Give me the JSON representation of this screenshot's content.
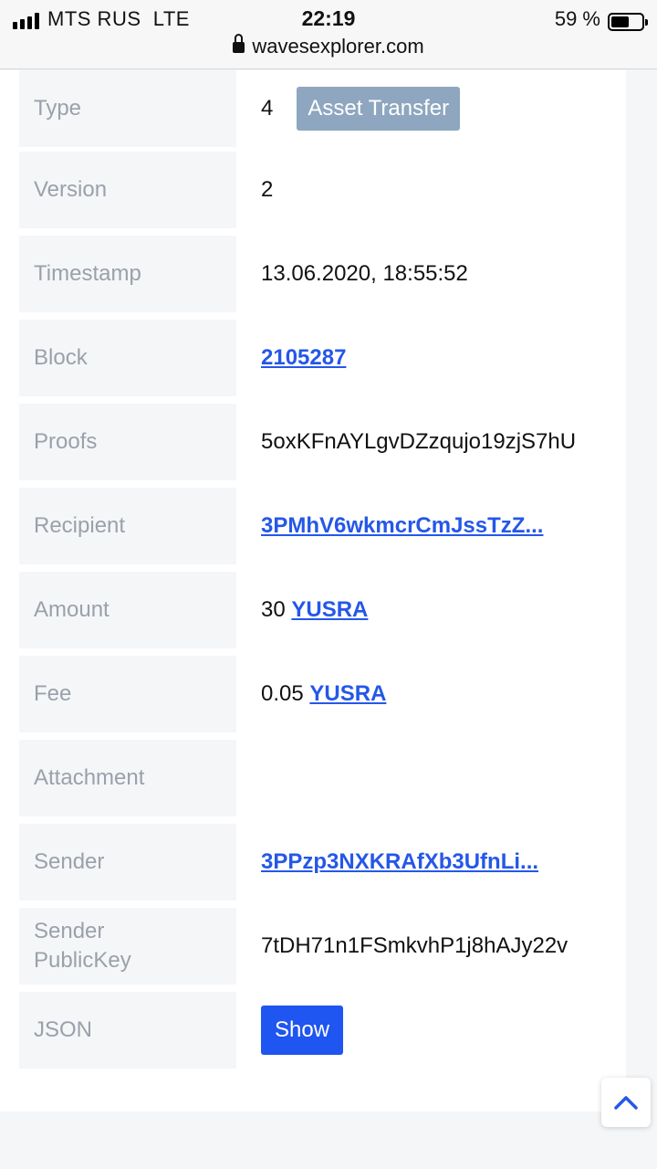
{
  "status_bar": {
    "carrier": "MTS RUS",
    "network": "LTE",
    "time": "22:19",
    "battery_percent": "59 %",
    "battery_level": 0.59,
    "url": "wavesexplorer.com"
  },
  "transaction": {
    "type": {
      "label": "Type",
      "value": "4",
      "badge": "Asset Transfer"
    },
    "version": {
      "label": "Version",
      "value": "2"
    },
    "timestamp": {
      "label": "Timestamp",
      "value": "13.06.2020, 18:55:52"
    },
    "block": {
      "label": "Block",
      "value": "2105287"
    },
    "proofs": {
      "label": "Proofs",
      "value": "5oxKFnAYLgvDZzqujo19zjS7hU"
    },
    "recipient": {
      "label": "Recipient",
      "value": "3PMhV6wkmcrCmJssTzZ..."
    },
    "amount": {
      "label": "Amount",
      "value": "30",
      "asset": "YUSRA"
    },
    "fee": {
      "label": "Fee",
      "value": "0.05",
      "asset": "YUSRA"
    },
    "attachment": {
      "label": "Attachment",
      "value": ""
    },
    "sender": {
      "label": "Sender",
      "value": "3PPzp3NXKRAfXb3UfnLi..."
    },
    "sender_public_key": {
      "label_line1": "Sender",
      "label_line2": "PublicKey",
      "value": "7tDH71n1FSmkvhP1j8hAJy22v"
    },
    "json": {
      "label": "JSON",
      "button": "Show"
    }
  },
  "icons": {
    "scroll_top": "chevron-up-icon",
    "lock": "lock-icon",
    "signal": "signal-bars-icon",
    "battery": "battery-icon"
  },
  "colors": {
    "link": "#2557e8",
    "badge": "#8ea6bf",
    "button": "#1f55f0",
    "label_text": "#9aa1ab",
    "label_bg": "#f5f6f8"
  }
}
